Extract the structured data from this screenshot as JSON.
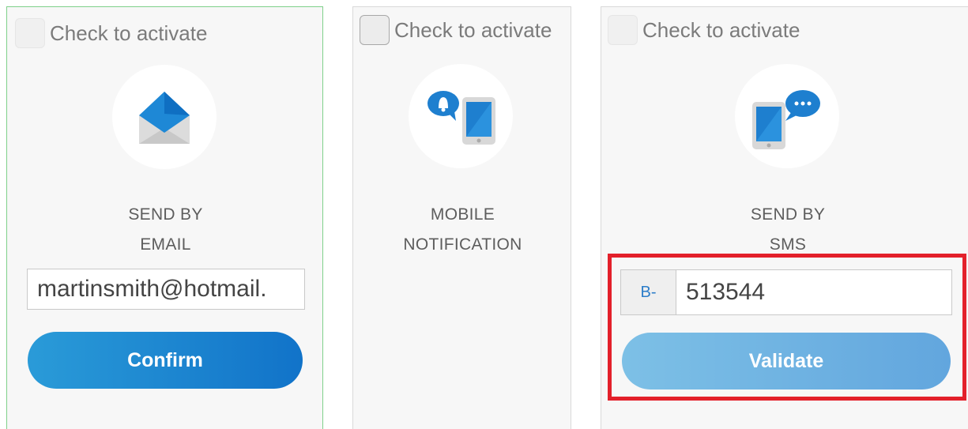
{
  "cards": [
    {
      "checkbox_label": "Check to activate",
      "title_line1": "SEND BY",
      "title_line2": "EMAIL",
      "icon": "email-envelope-icon",
      "input_value": "martinsmith@hotmail.",
      "button_label": "Confirm"
    },
    {
      "checkbox_label": "Check to activate",
      "title_line1": "MOBILE",
      "title_line2": "NOTIFICATION",
      "icon": "mobile-notification-icon"
    },
    {
      "checkbox_label": "Check to activate",
      "title_line1": "SEND BY",
      "title_line2": "SMS",
      "icon": "sms-chat-icon",
      "code_prefix": "B-",
      "code_value": "513544",
      "button_label": "Validate"
    }
  ],
  "colors": {
    "primary_button": "#1173c9",
    "disabled_button": "#7dc0e6",
    "active_border": "#7fd08a",
    "highlight": "#e3202b",
    "prefix_text": "#2c7dc9"
  }
}
